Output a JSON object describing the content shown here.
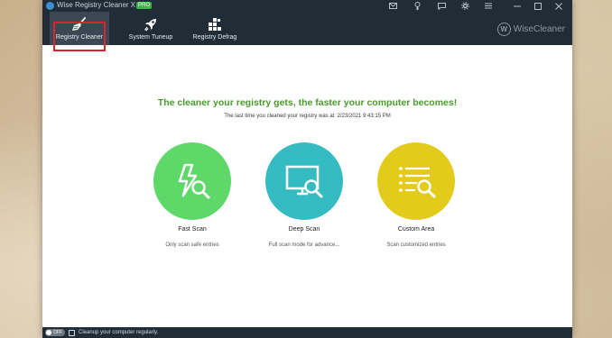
{
  "window": {
    "title": "Wise Registry Cleaner X",
    "badge": "PRO",
    "titlebar_icons": [
      "mail-icon",
      "skin-icon",
      "feedback-icon",
      "settings-icon",
      "menu-icon",
      "minimize-icon",
      "maximize-icon",
      "close-icon"
    ]
  },
  "toolbar": {
    "items": [
      {
        "label": "Registry Cleaner",
        "icon": "broom-icon",
        "active": true
      },
      {
        "label": "System Tuneup",
        "icon": "rocket-icon",
        "active": false
      },
      {
        "label": "Registry Defrag",
        "icon": "defrag-blocks-icon",
        "active": false
      }
    ],
    "brand": "WiseCleaner",
    "brand_mark": "W"
  },
  "main": {
    "headline": "The cleaner your registry gets, the faster your computer becomes!",
    "last_cleaned": "The last time you cleaned your registry was at: 2/23/2021 9:43:15 PM",
    "scans": [
      {
        "title": "Fast Scan",
        "description": "Only scan safe entries",
        "color": "#5fd86a",
        "icon": "lightning-magnifier-icon"
      },
      {
        "title": "Deep Scan",
        "description": "Full scan mode for advance...",
        "color": "#35bcc2",
        "icon": "monitor-magnifier-icon"
      },
      {
        "title": "Custom Area",
        "description": "Scan customized entries",
        "color": "#e3cb1c",
        "icon": "list-magnifier-icon"
      }
    ]
  },
  "statusbar": {
    "toggle_label": "OFF",
    "message": "Cleanup your computer regularly."
  },
  "colors": {
    "titlebar": "#202c36",
    "headline": "#4a9a2c",
    "highlight": "#d8262e"
  }
}
